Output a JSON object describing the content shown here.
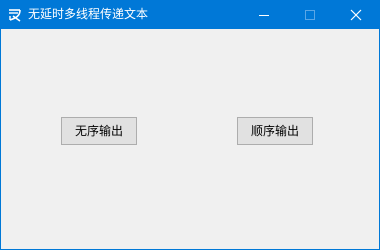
{
  "window": {
    "title": "无延时多线程传递文本",
    "app_icon": "app-logo-icon",
    "controls": [
      "minimize-icon",
      "maximize-icon",
      "close-icon"
    ]
  },
  "buttons": {
    "unordered_label": "无序输出",
    "ordered_label": "顺序输出"
  },
  "colors": {
    "titlebar": "#0078d7",
    "client_background": "#f0f0f0",
    "button_face": "#e1e1e1",
    "button_border": "#adadad"
  }
}
